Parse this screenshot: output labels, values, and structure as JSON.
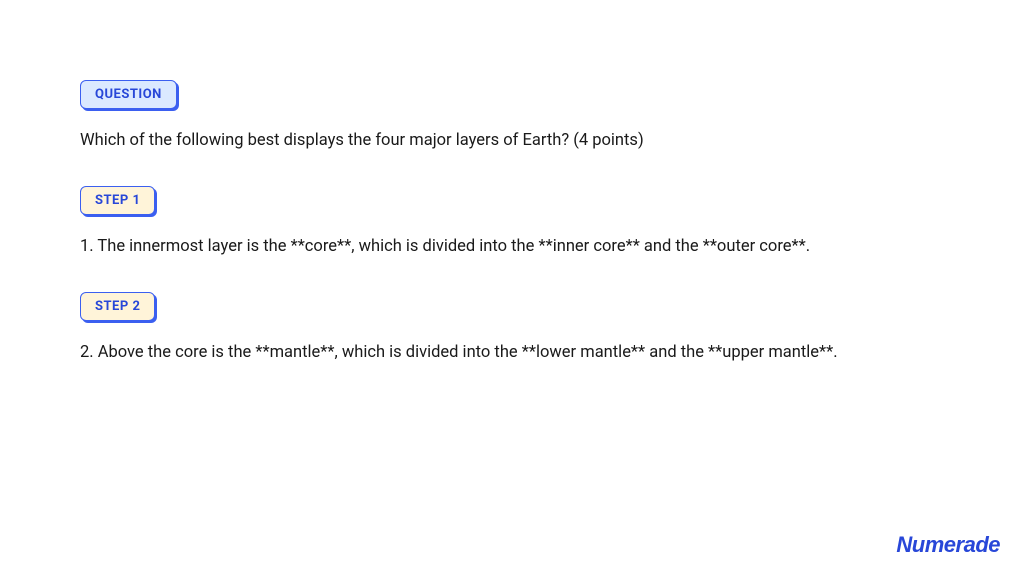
{
  "question": {
    "badge": "QUESTION",
    "text": "Which of the following best displays the four major layers of Earth? (4 points)"
  },
  "steps": [
    {
      "badge": "STEP 1",
      "text": "1. The innermost layer is the **core**, which is divided into the **inner core** and the **outer core**."
    },
    {
      "badge": "STEP 2",
      "text": "2. Above the core is the **mantle**, which is divided into the **lower mantle** and the **upper mantle**."
    }
  ],
  "brand": "Numerade"
}
